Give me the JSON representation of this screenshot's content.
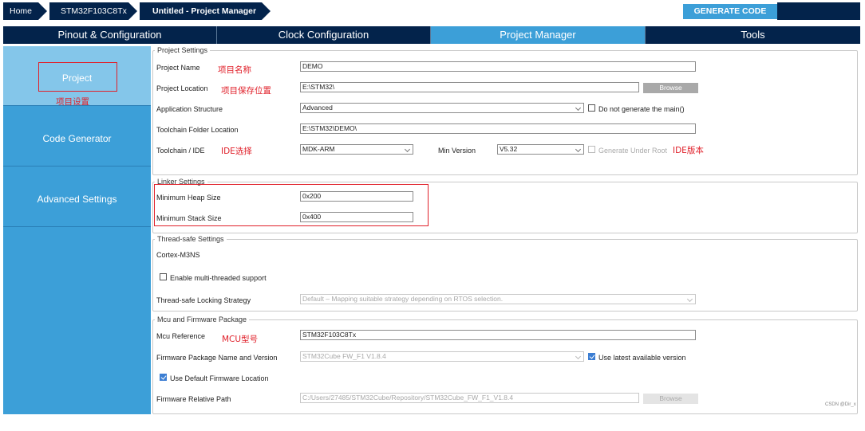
{
  "breadcrumbs": [
    "Home",
    "STM32F103C8Tx",
    "Untitled - Project Manager"
  ],
  "generate_button": "GENERATE CODE",
  "tabs": [
    "Pinout & Configuration",
    "Clock Configuration",
    "Project Manager",
    "Tools"
  ],
  "active_tab": "Project Manager",
  "sidebar": {
    "items": [
      {
        "label": "Project",
        "active": true
      },
      {
        "label": "Code Generator",
        "active": false
      },
      {
        "label": "Advanced Settings",
        "active": false
      }
    ]
  },
  "project_settings": {
    "legend": "Project Settings",
    "project_name_label": "Project Name",
    "project_name_value": "DEMO",
    "project_location_label": "Project Location",
    "project_location_value": "E:\\STM32\\",
    "browse_label": "Browse",
    "app_structure_label": "Application Structure",
    "app_structure_value": "Advanced",
    "no_main_label": "Do not generate the main()",
    "toolchain_folder_label": "Toolchain Folder Location",
    "toolchain_folder_value": "E:\\STM32\\DEMO\\",
    "toolchain_ide_label": "Toolchain / IDE",
    "toolchain_ide_value": "MDK-ARM",
    "min_version_label": "Min Version",
    "min_version_value": "V5.32",
    "generate_under_root_label": "Generate Under Root"
  },
  "linker_settings": {
    "legend": "Linker Settings",
    "heap_label": "Minimum Heap Size",
    "heap_value": "0x200",
    "stack_label": "Minimum Stack Size",
    "stack_value": "0x400"
  },
  "thread_safe": {
    "legend": "Thread-safe Settings",
    "core": "Cortex-M3NS",
    "multithread_label": "Enable multi-threaded support",
    "locking_label": "Thread-safe Locking Strategy",
    "locking_value": "Default  –  Mapping suitable strategy depending on RTOS selection."
  },
  "mcu_firmware": {
    "legend": "Mcu and Firmware Package",
    "mcu_ref_label": "Mcu Reference",
    "mcu_ref_value": "STM32F103C8Tx",
    "fw_package_label": "Firmware Package Name and Version",
    "fw_package_value": "STM32Cube FW_F1 V1.8.4",
    "use_latest_label": "Use latest available version",
    "use_default_location_label": "Use Default Firmware Location",
    "fw_relative_path_label": "Firmware Relative Path",
    "fw_relative_path_value": "C:/Users/27485/STM32Cube/Repository/STM32Cube_FW_F1_V1.8.4",
    "browse_label": "Browse"
  },
  "annotations": {
    "project_setting": "项目设置",
    "project_name": "项目名称",
    "project_location": "项目保存位置",
    "ide_choice": "IDE选择",
    "ide_version": "IDE版本",
    "mcu_model": "MCU型号"
  },
  "watermark": "CSDN @Dir_x",
  "colors": {
    "navy": "#03234b",
    "accent_blue": "#3c9fd8",
    "sidebar_active": "#84c6ea",
    "annotation_red": "#e0202a"
  }
}
